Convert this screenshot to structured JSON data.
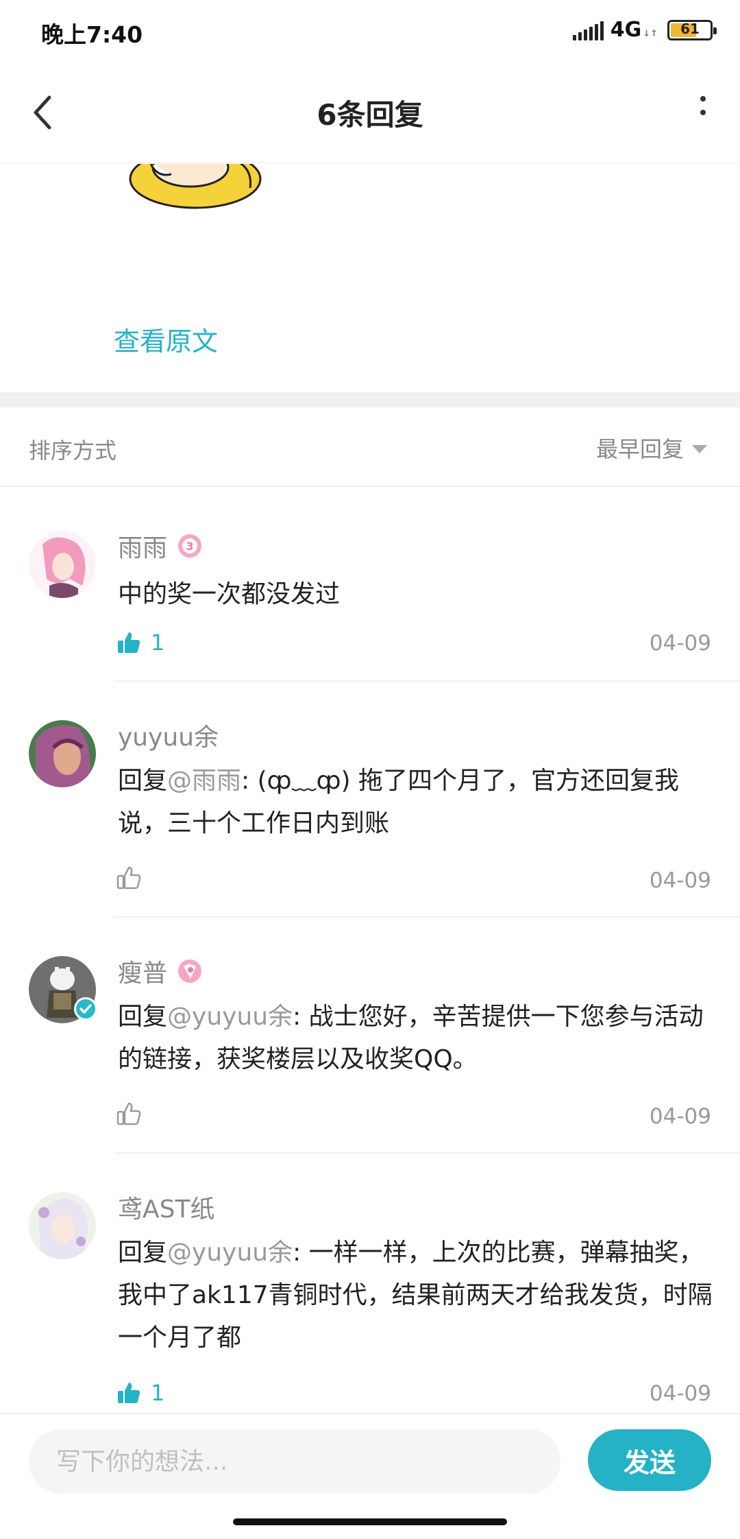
{
  "status_bar": {
    "time": "晚上7:40",
    "network": "4G",
    "battery": "61",
    "battery_level": 0.61
  },
  "header": {
    "title": "6条回复"
  },
  "origin": {
    "view_original": "查看原文"
  },
  "sort": {
    "label": "排序方式",
    "value": "最早回复"
  },
  "replies": [
    {
      "name": "雨雨",
      "text": "中的奖一次都没发过",
      "likes": "1",
      "date": "04-09"
    },
    {
      "name": "yuyuu余",
      "reply_prefix": "回复",
      "mention": "@雨雨",
      "text": ": (ȹ﹏ȹ) 拖了四个月了，官方还回复我说，三十个工作日内到账",
      "date": "04-09"
    },
    {
      "name": "瘦普",
      "reply_prefix": "回复",
      "mention": "@yuyuu余",
      "text": ": 战士您好，辛苦提供一下您参与活动的链接，获奖楼层以及收奖QQ。",
      "date": "04-09"
    },
    {
      "name": "鸢AST纸",
      "reply_prefix": "回复",
      "mention": "@yuyuu余",
      "text": ": 一样一样，上次的比赛，弹幕抽奖，我中了ak117青铜时代，结果前两天才给我发货，时隔一个月了都",
      "likes": "1",
      "date": "04-09"
    }
  ],
  "composer": {
    "placeholder": "写下你的想法...",
    "send": "发送"
  },
  "colors": {
    "accent": "#25b2c6",
    "muted": "#888888"
  }
}
